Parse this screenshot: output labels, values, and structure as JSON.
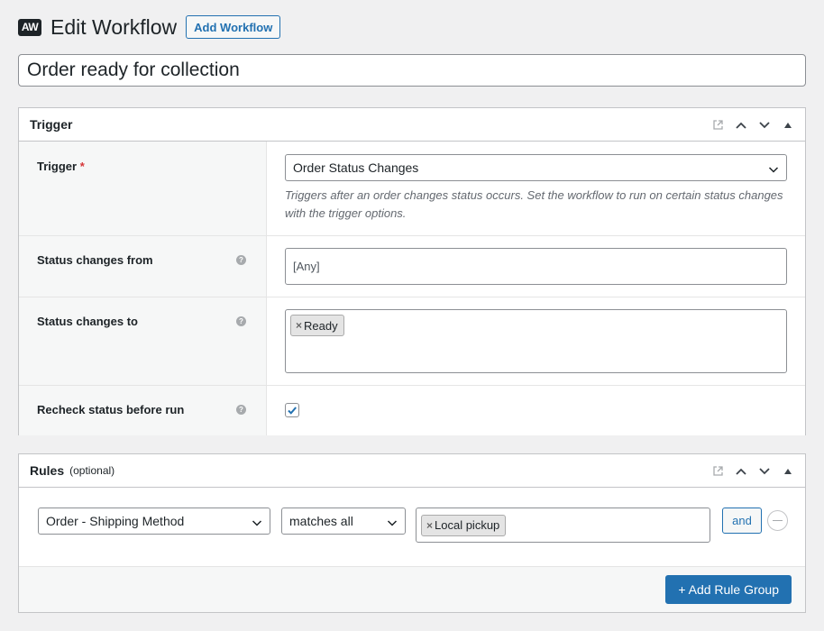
{
  "header": {
    "logo_text": "AW",
    "title": "Edit Workflow",
    "add_button": "Add Workflow"
  },
  "workflow": {
    "title": "Order ready for collection"
  },
  "trigger_box": {
    "title": "Trigger",
    "fields": {
      "trigger": {
        "label": "Trigger",
        "required_mark": "*",
        "value": "Order Status Changes",
        "description": "Triggers after an order changes status occurs. Set the workflow to run on certain status changes with the trigger options."
      },
      "status_from": {
        "label": "Status changes from",
        "placeholder": "[Any]"
      },
      "status_to": {
        "label": "Status changes to",
        "chips": [
          "Ready"
        ]
      },
      "recheck": {
        "label": "Recheck status before run",
        "checked": true
      }
    },
    "help_icon": "?"
  },
  "rules_box": {
    "title": "Rules",
    "subtitle": "(optional)",
    "rule": {
      "field": "Order - Shipping Method",
      "compare": "matches all",
      "chips": [
        "Local pickup"
      ]
    },
    "and_label": "and",
    "add_group_label": "+ Add Rule Group"
  },
  "icons": {
    "chip_remove": "×"
  },
  "colors": {
    "accent": "#2271b1",
    "required": "#d63638",
    "background": "#f0f0f1"
  }
}
